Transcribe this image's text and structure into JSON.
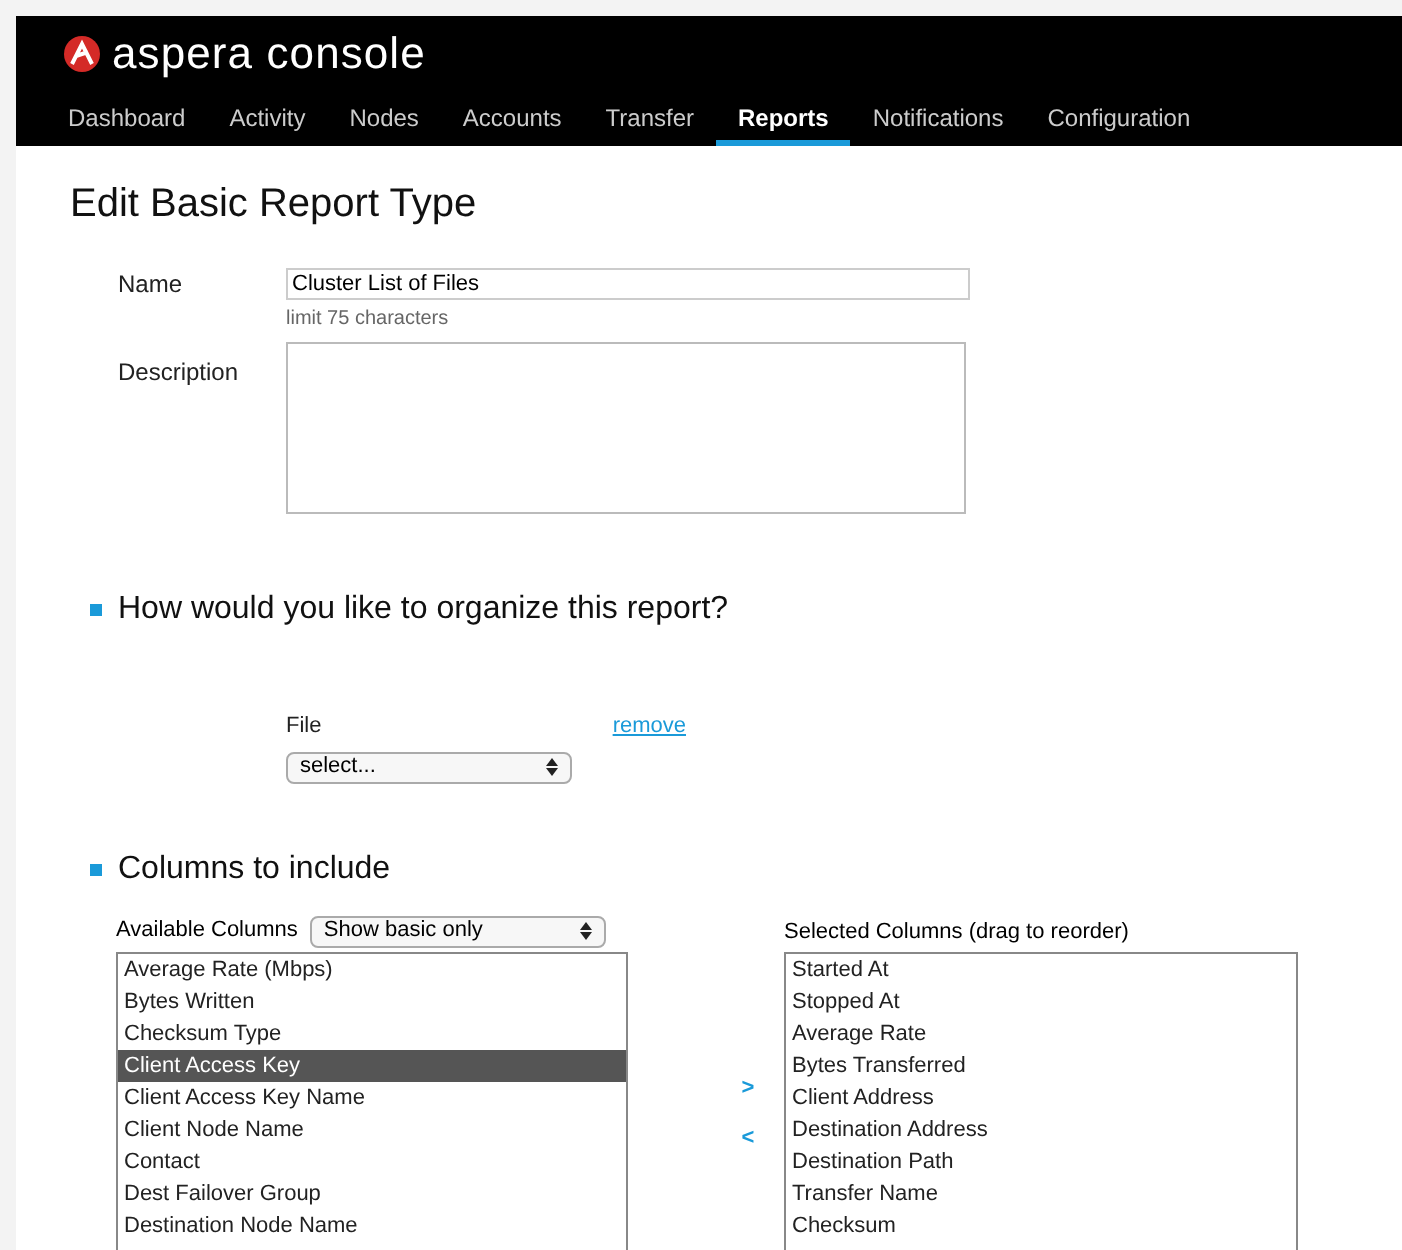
{
  "app": {
    "logo_text": "aspera console"
  },
  "tabs": [
    {
      "label": "Dashboard",
      "selected": false
    },
    {
      "label": "Activity",
      "selected": false
    },
    {
      "label": "Nodes",
      "selected": false
    },
    {
      "label": "Accounts",
      "selected": false
    },
    {
      "label": "Transfer",
      "selected": false
    },
    {
      "label": "Reports",
      "selected": true
    },
    {
      "label": "Notifications",
      "selected": false
    },
    {
      "label": "Configuration",
      "selected": false
    }
  ],
  "title": "Edit Basic Report Type",
  "form": {
    "name_label": "Name",
    "name_value": "Cluster List of Files",
    "name_hint": "limit 75 characters",
    "description_label": "Description"
  },
  "organize": {
    "heading": "How would you like to organize this report?",
    "field_label": "File",
    "remove_link": "remove",
    "select_value": "select..."
  },
  "columns": {
    "heading": "Columns to include",
    "available_label": "Available Columns",
    "filter_value": "Show basic only",
    "selected_label": "Selected Columns (drag to reorder)",
    "add_button": ">",
    "remove_button": "<",
    "available": [
      {
        "label": "Average Rate (Mbps)",
        "selected": false
      },
      {
        "label": "Bytes Written",
        "selected": false
      },
      {
        "label": "Checksum Type",
        "selected": false
      },
      {
        "label": "Client Access Key",
        "selected": true
      },
      {
        "label": "Client Access Key Name",
        "selected": false
      },
      {
        "label": "Client Node Name",
        "selected": false
      },
      {
        "label": "Contact",
        "selected": false
      },
      {
        "label": "Dest Failover Group",
        "selected": false
      },
      {
        "label": "Destination Node Name",
        "selected": false
      }
    ],
    "chosen": [
      {
        "label": "Started At",
        "selected": false
      },
      {
        "label": "Stopped At",
        "selected": false
      },
      {
        "label": "Average Rate",
        "selected": false
      },
      {
        "label": "Bytes Transferred",
        "selected": false
      },
      {
        "label": "Client Address",
        "selected": false
      },
      {
        "label": "Destination Address",
        "selected": false
      },
      {
        "label": "Destination Path",
        "selected": false
      },
      {
        "label": "Transfer Name",
        "selected": false
      },
      {
        "label": "Checksum",
        "selected": false
      }
    ]
  }
}
